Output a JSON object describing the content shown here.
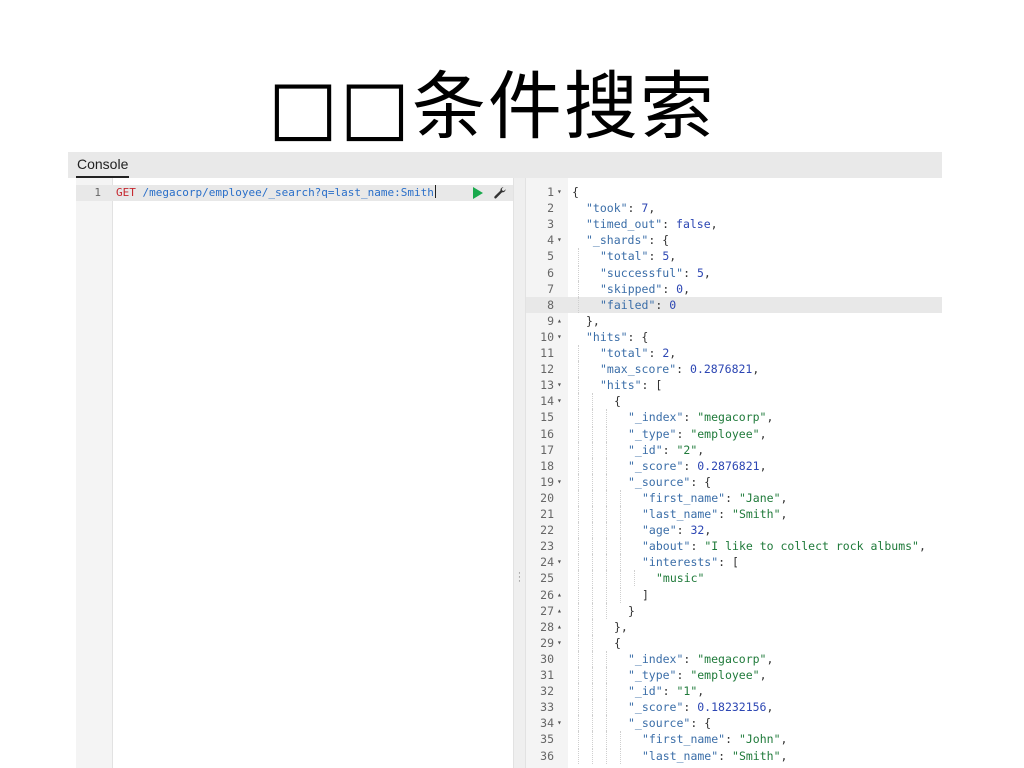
{
  "slide": {
    "title": "□□条件搜索"
  },
  "console": {
    "tab_label": "Console",
    "request": {
      "line_number": "1",
      "method": "GET",
      "url": "/megacorp/employee/_search?q=last_name:Smith",
      "run_icon": "play-icon",
      "settings_icon": "wrench-icon"
    },
    "divider_icon": "vertical-grip-icon",
    "response": {
      "active_line": 8,
      "lines": [
        {
          "n": "1",
          "fold": "▾",
          "indent": 0,
          "tokens": [
            [
              "p",
              "{"
            ]
          ]
        },
        {
          "n": "2",
          "fold": "",
          "indent": 1,
          "tokens": [
            [
              "k",
              "\"took\""
            ],
            [
              "p",
              ": "
            ],
            [
              "n",
              "7"
            ],
            [
              "p",
              ","
            ]
          ]
        },
        {
          "n": "3",
          "fold": "",
          "indent": 1,
          "tokens": [
            [
              "k",
              "\"timed_out\""
            ],
            [
              "p",
              ": "
            ],
            [
              "b",
              "false"
            ],
            [
              "p",
              ","
            ]
          ]
        },
        {
          "n": "4",
          "fold": "▾",
          "indent": 1,
          "tokens": [
            [
              "k",
              "\"_shards\""
            ],
            [
              "p",
              ": {"
            ]
          ]
        },
        {
          "n": "5",
          "fold": "",
          "indent": 2,
          "tokens": [
            [
              "k",
              "\"total\""
            ],
            [
              "p",
              ": "
            ],
            [
              "n",
              "5"
            ],
            [
              "p",
              ","
            ]
          ]
        },
        {
          "n": "6",
          "fold": "",
          "indent": 2,
          "tokens": [
            [
              "k",
              "\"successful\""
            ],
            [
              "p",
              ": "
            ],
            [
              "n",
              "5"
            ],
            [
              "p",
              ","
            ]
          ]
        },
        {
          "n": "7",
          "fold": "",
          "indent": 2,
          "tokens": [
            [
              "k",
              "\"skipped\""
            ],
            [
              "p",
              ": "
            ],
            [
              "n",
              "0"
            ],
            [
              "p",
              ","
            ]
          ]
        },
        {
          "n": "8",
          "fold": "",
          "indent": 2,
          "tokens": [
            [
              "k",
              "\"failed\""
            ],
            [
              "p",
              ": "
            ],
            [
              "n",
              "0"
            ]
          ]
        },
        {
          "n": "9",
          "fold": "▴",
          "indent": 1,
          "tokens": [
            [
              "p",
              "},"
            ]
          ]
        },
        {
          "n": "10",
          "fold": "▾",
          "indent": 1,
          "tokens": [
            [
              "k",
              "\"hits\""
            ],
            [
              "p",
              ": {"
            ]
          ]
        },
        {
          "n": "11",
          "fold": "",
          "indent": 2,
          "tokens": [
            [
              "k",
              "\"total\""
            ],
            [
              "p",
              ": "
            ],
            [
              "n",
              "2"
            ],
            [
              "p",
              ","
            ]
          ]
        },
        {
          "n": "12",
          "fold": "",
          "indent": 2,
          "tokens": [
            [
              "k",
              "\"max_score\""
            ],
            [
              "p",
              ": "
            ],
            [
              "n",
              "0.2876821"
            ],
            [
              "p",
              ","
            ]
          ]
        },
        {
          "n": "13",
          "fold": "▾",
          "indent": 2,
          "tokens": [
            [
              "k",
              "\"hits\""
            ],
            [
              "p",
              ": ["
            ]
          ]
        },
        {
          "n": "14",
          "fold": "▾",
          "indent": 3,
          "tokens": [
            [
              "p",
              "{"
            ]
          ]
        },
        {
          "n": "15",
          "fold": "",
          "indent": 4,
          "tokens": [
            [
              "k",
              "\"_index\""
            ],
            [
              "p",
              ": "
            ],
            [
              "s",
              "\"megacorp\""
            ],
            [
              "p",
              ","
            ]
          ]
        },
        {
          "n": "16",
          "fold": "",
          "indent": 4,
          "tokens": [
            [
              "k",
              "\"_type\""
            ],
            [
              "p",
              ": "
            ],
            [
              "s",
              "\"employee\""
            ],
            [
              "p",
              ","
            ]
          ]
        },
        {
          "n": "17",
          "fold": "",
          "indent": 4,
          "tokens": [
            [
              "k",
              "\"_id\""
            ],
            [
              "p",
              ": "
            ],
            [
              "s",
              "\"2\""
            ],
            [
              "p",
              ","
            ]
          ]
        },
        {
          "n": "18",
          "fold": "",
          "indent": 4,
          "tokens": [
            [
              "k",
              "\"_score\""
            ],
            [
              "p",
              ": "
            ],
            [
              "n",
              "0.2876821"
            ],
            [
              "p",
              ","
            ]
          ]
        },
        {
          "n": "19",
          "fold": "▾",
          "indent": 4,
          "tokens": [
            [
              "k",
              "\"_source\""
            ],
            [
              "p",
              ": {"
            ]
          ]
        },
        {
          "n": "20",
          "fold": "",
          "indent": 5,
          "tokens": [
            [
              "k",
              "\"first_name\""
            ],
            [
              "p",
              ": "
            ],
            [
              "s",
              "\"Jane\""
            ],
            [
              "p",
              ","
            ]
          ]
        },
        {
          "n": "21",
          "fold": "",
          "indent": 5,
          "tokens": [
            [
              "k",
              "\"last_name\""
            ],
            [
              "p",
              ": "
            ],
            [
              "s",
              "\"Smith\""
            ],
            [
              "p",
              ","
            ]
          ]
        },
        {
          "n": "22",
          "fold": "",
          "indent": 5,
          "tokens": [
            [
              "k",
              "\"age\""
            ],
            [
              "p",
              ": "
            ],
            [
              "n",
              "32"
            ],
            [
              "p",
              ","
            ]
          ]
        },
        {
          "n": "23",
          "fold": "",
          "indent": 5,
          "tokens": [
            [
              "k",
              "\"about\""
            ],
            [
              "p",
              ": "
            ],
            [
              "s",
              "\"I like to collect rock albums\""
            ],
            [
              "p",
              ","
            ]
          ]
        },
        {
          "n": "24",
          "fold": "▾",
          "indent": 5,
          "tokens": [
            [
              "k",
              "\"interests\""
            ],
            [
              "p",
              ": ["
            ]
          ]
        },
        {
          "n": "25",
          "fold": "",
          "indent": 6,
          "tokens": [
            [
              "s",
              "\"music\""
            ]
          ]
        },
        {
          "n": "26",
          "fold": "▴",
          "indent": 5,
          "tokens": [
            [
              "p",
              "]"
            ]
          ]
        },
        {
          "n": "27",
          "fold": "▴",
          "indent": 4,
          "tokens": [
            [
              "p",
              "}"
            ]
          ]
        },
        {
          "n": "28",
          "fold": "▴",
          "indent": 3,
          "tokens": [
            [
              "p",
              "},"
            ]
          ]
        },
        {
          "n": "29",
          "fold": "▾",
          "indent": 3,
          "tokens": [
            [
              "p",
              "{"
            ]
          ]
        },
        {
          "n": "30",
          "fold": "",
          "indent": 4,
          "tokens": [
            [
              "k",
              "\"_index\""
            ],
            [
              "p",
              ": "
            ],
            [
              "s",
              "\"megacorp\""
            ],
            [
              "p",
              ","
            ]
          ]
        },
        {
          "n": "31",
          "fold": "",
          "indent": 4,
          "tokens": [
            [
              "k",
              "\"_type\""
            ],
            [
              "p",
              ": "
            ],
            [
              "s",
              "\"employee\""
            ],
            [
              "p",
              ","
            ]
          ]
        },
        {
          "n": "32",
          "fold": "",
          "indent": 4,
          "tokens": [
            [
              "k",
              "\"_id\""
            ],
            [
              "p",
              ": "
            ],
            [
              "s",
              "\"1\""
            ],
            [
              "p",
              ","
            ]
          ]
        },
        {
          "n": "33",
          "fold": "",
          "indent": 4,
          "tokens": [
            [
              "k",
              "\"_score\""
            ],
            [
              "p",
              ": "
            ],
            [
              "n",
              "0.18232156"
            ],
            [
              "p",
              ","
            ]
          ]
        },
        {
          "n": "34",
          "fold": "▾",
          "indent": 4,
          "tokens": [
            [
              "k",
              "\"_source\""
            ],
            [
              "p",
              ": {"
            ]
          ]
        },
        {
          "n": "35",
          "fold": "",
          "indent": 5,
          "tokens": [
            [
              "k",
              "\"first_name\""
            ],
            [
              "p",
              ": "
            ],
            [
              "s",
              "\"John\""
            ],
            [
              "p",
              ","
            ]
          ]
        },
        {
          "n": "36",
          "fold": "",
          "indent": 5,
          "tokens": [
            [
              "k",
              "\"last_name\""
            ],
            [
              "p",
              ": "
            ],
            [
              "s",
              "\"Smith\""
            ],
            [
              "p",
              ","
            ]
          ]
        }
      ]
    },
    "colors": {
      "method": "#c5262e",
      "url": "#2a6fc9",
      "run": "#1aa94d",
      "header_bg": "#e9e9e9"
    }
  }
}
